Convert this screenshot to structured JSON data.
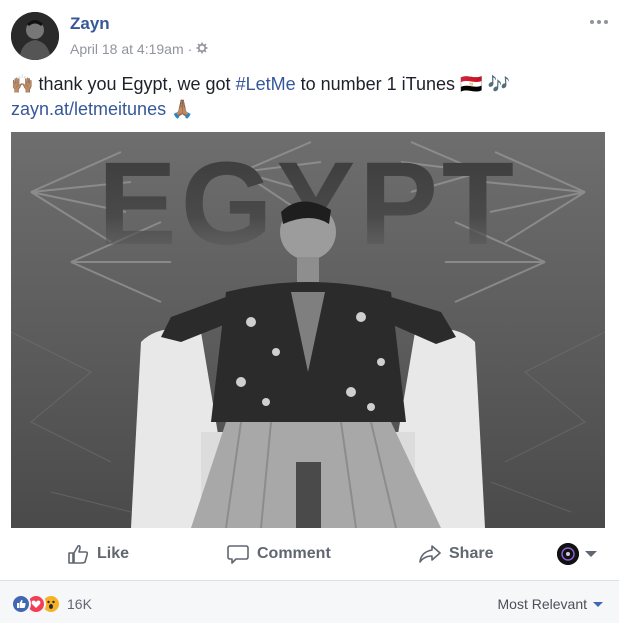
{
  "post": {
    "author": "Zayn",
    "timestamp": "April 18 at 4:19am",
    "separator": "·",
    "privacy_icon": "globe-gear-icon",
    "more_icon": "more-options-icon"
  },
  "text": {
    "emoji_start": "🙌🏽",
    "part1": "thank you Egypt, we got ",
    "hashtag": "#LetMe",
    "part2": " to number 1 iTunes ",
    "emoji_flag": "🇪🇬",
    "emoji_music": "🎶",
    "link": "zayn.at/letmeitunes",
    "emoji_pray": "🙏🏽"
  },
  "photo": {
    "overlay_text": "EGYPT"
  },
  "actions": {
    "like": "Like",
    "comment": "Comment",
    "share": "Share"
  },
  "footer": {
    "reaction_count": "16K",
    "sort_label": "Most Relevant"
  },
  "colors": {
    "link": "#365899",
    "secondary_text": "#90949c",
    "like_blue": "#4267b2",
    "love_red": "#f33e58",
    "wow_yellow": "#f7b125"
  }
}
